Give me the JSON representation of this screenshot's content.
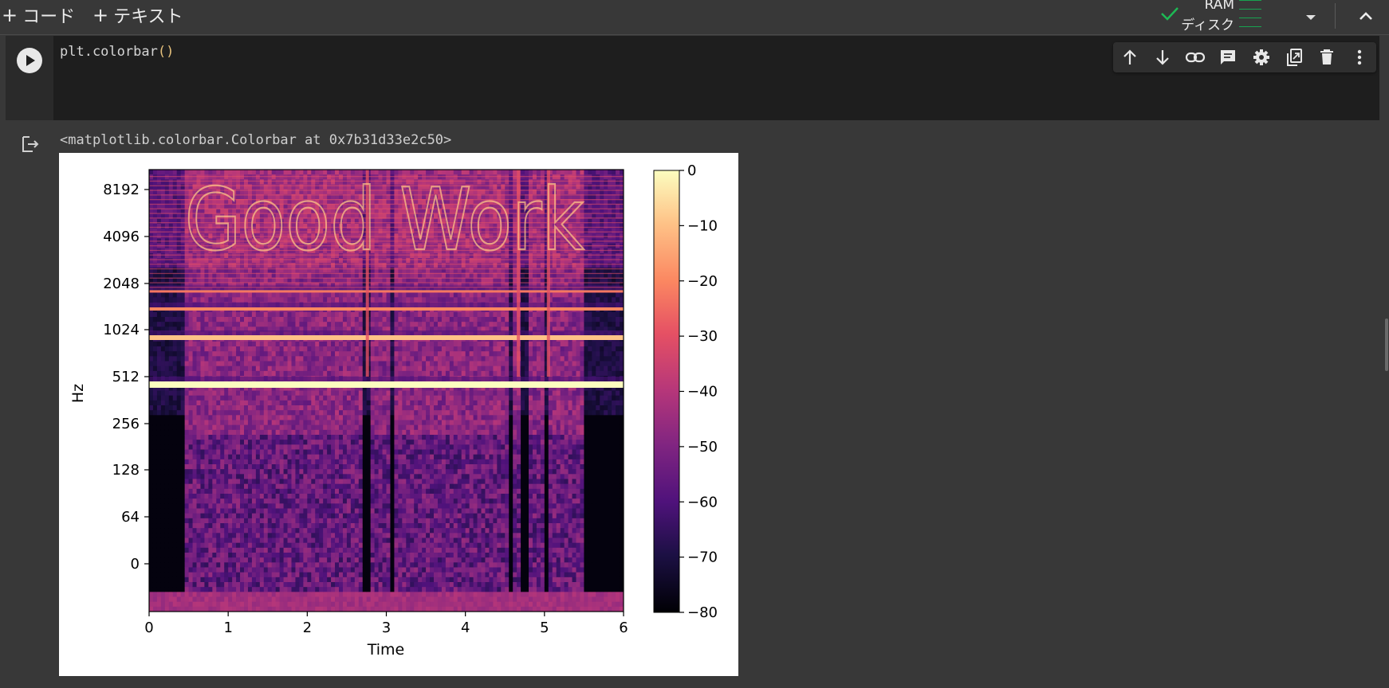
{
  "toolbar": {
    "add_code_label": "コード",
    "add_text_label": "テキスト",
    "ram_label": "RAM",
    "disk_label": "ディスク"
  },
  "cell": {
    "code_line": "plt.colorbar",
    "code_paren": "()"
  },
  "output": {
    "text": "<matplotlib.colorbar.Colorbar at 0x7b31d33e2c50>"
  },
  "colors": {
    "status_check": "#1db954",
    "background": "#383838",
    "cell_bg": "#1e1e1e"
  },
  "icons": [
    "plus-icon",
    "check-icon",
    "dropdown-icon",
    "chevron-up-icon",
    "play-icon",
    "arrow-up-icon",
    "arrow-down-icon",
    "link-icon",
    "comment-icon",
    "gear-icon",
    "mirror-icon",
    "trash-icon",
    "more-vert-icon",
    "output-icon"
  ],
  "chart_data": {
    "type": "heatmap",
    "title": "",
    "xlabel": "Time",
    "ylabel": "Hz",
    "xlim": [
      0,
      6
    ],
    "x_ticks": [
      "0",
      "1",
      "2",
      "3",
      "4",
      "5",
      "6"
    ],
    "y_ticks": [
      "0",
      "64",
      "128",
      "256",
      "512",
      "1024",
      "2048",
      "4096",
      "8192"
    ],
    "colorbar": {
      "range": [
        -80,
        0
      ],
      "ticks": [
        "0",
        "−10",
        "−20",
        "−30",
        "−40",
        "−50",
        "−60",
        "−70",
        "−80"
      ],
      "colormap": "magma"
    },
    "y_scale": "log2",
    "hidden_text": "Good Work",
    "harmonic_lines_hz": [
      370,
      740,
      1110,
      1480
    ]
  }
}
